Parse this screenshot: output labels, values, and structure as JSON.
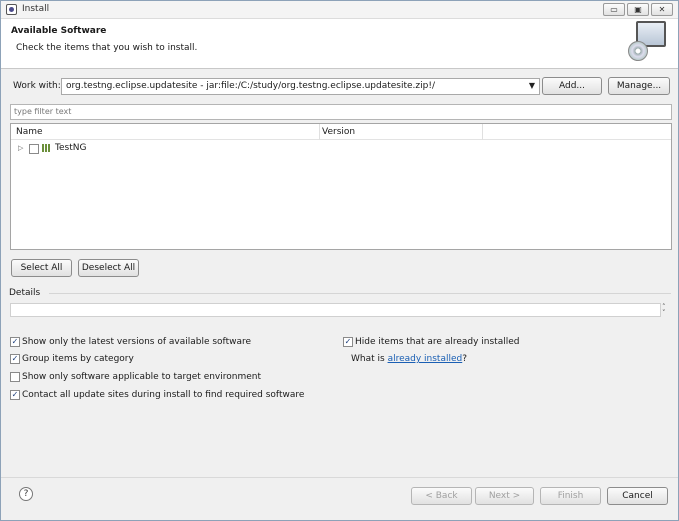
{
  "window": {
    "title": "Install",
    "controls": [
      "▭",
      "▣",
      "✕"
    ]
  },
  "header": {
    "title": "Available Software",
    "subtitle": "Check the items that you wish to install."
  },
  "work_with": {
    "label": "Work with:",
    "value": "org.testng.eclipse.updatesite - jar:file:/C:/study/org.testng.eclipse.updatesite.zip!/",
    "add_label": "Add...",
    "manage_label": "Manage..."
  },
  "filter": {
    "placeholder": "type filter text"
  },
  "tree": {
    "columns": [
      "Name",
      "Version"
    ],
    "items": [
      {
        "label": "TestNG",
        "version": ""
      }
    ]
  },
  "selection": {
    "select_all": "Select All",
    "deselect_all": "Deselect All"
  },
  "details": {
    "label": "Details"
  },
  "options": {
    "show_latest": {
      "label": "Show only the latest versions of available software",
      "checked": true
    },
    "group_by_category": {
      "label": "Group items by category",
      "checked": true
    },
    "applicable_only": {
      "label": "Show only software applicable to target environment",
      "checked": false
    },
    "contact_sites": {
      "label": "Contact all update sites during install to find required software",
      "checked": true
    },
    "hide_installed": {
      "label": "Hide items that are already installed",
      "checked": true
    },
    "what_is_prefix": "What is ",
    "what_is_link": "already installed",
    "what_is_suffix": "?"
  },
  "footer": {
    "help": "?",
    "back": "< Back",
    "next": "Next >",
    "finish": "Finish",
    "cancel": "Cancel"
  }
}
